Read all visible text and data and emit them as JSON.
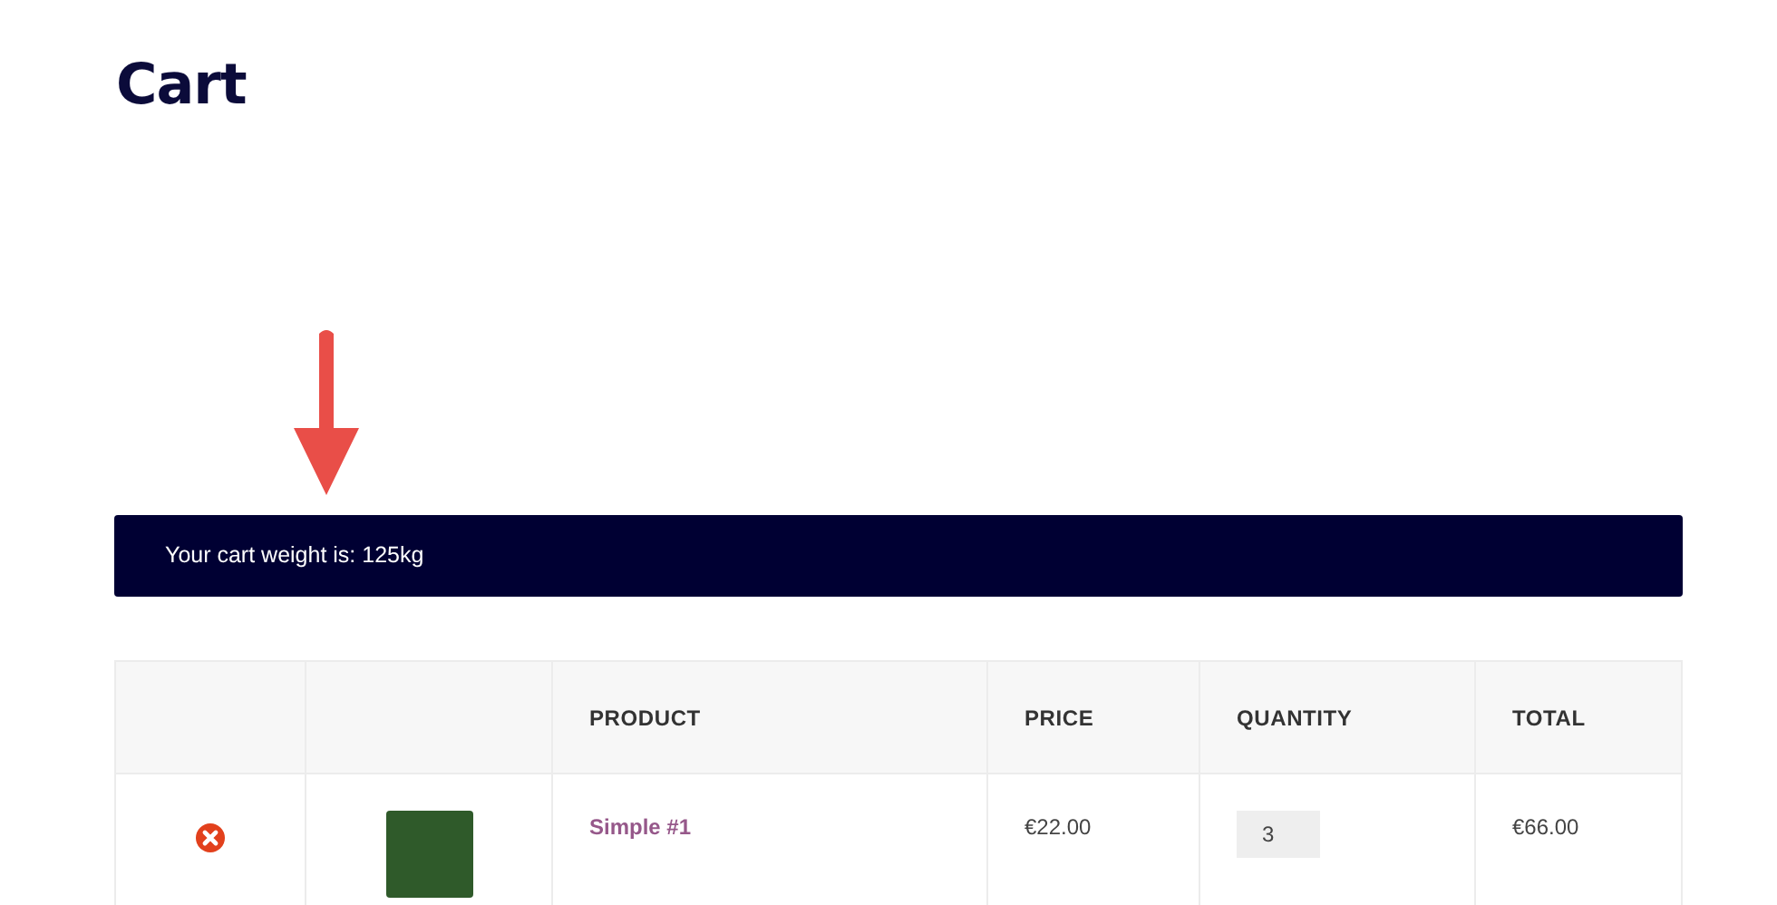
{
  "page": {
    "title": "Cart"
  },
  "notice": {
    "text": "Your cart weight is: 125kg"
  },
  "table": {
    "columns": [
      "PRODUCT",
      "PRICE",
      "QUANTITY",
      "TOTAL"
    ],
    "rows": [
      {
        "product": "Simple #1",
        "price": "€22.00",
        "quantity": "3",
        "total": "€66.00"
      }
    ]
  }
}
